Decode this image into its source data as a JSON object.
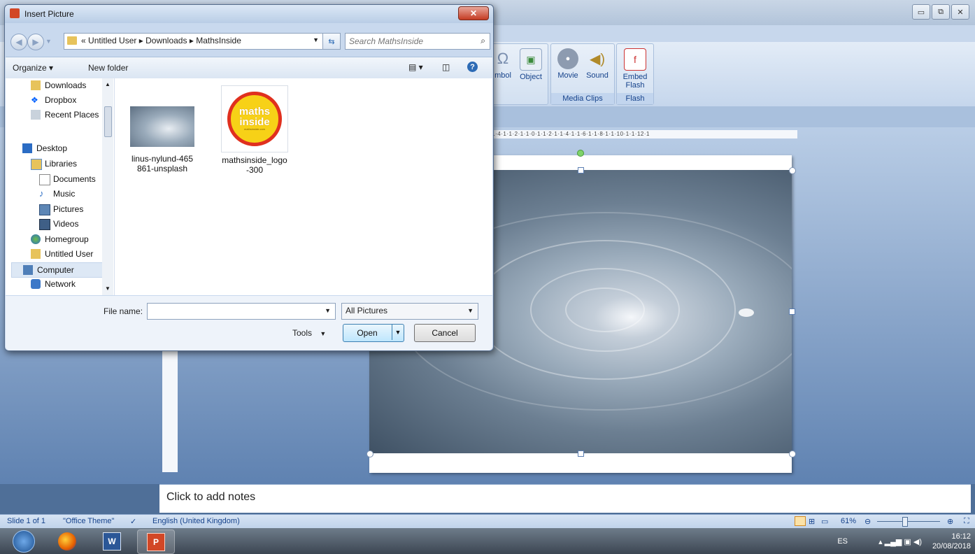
{
  "dialog": {
    "title": "Insert Picture",
    "breadcrumb": {
      "overflow": "«",
      "parts": [
        "Untitled User",
        "Downloads",
        "MathsInside"
      ],
      "separator": "▸"
    },
    "search_placeholder": "Search MathsInside",
    "toolbar": {
      "organize": "Organize ▾",
      "new_folder": "New folder"
    },
    "nav_items": [
      {
        "label": "Downloads",
        "icon": "downloads-folder-icon"
      },
      {
        "label": "Dropbox",
        "icon": "dropbox-icon"
      },
      {
        "label": "Recent Places",
        "icon": "recent-places-icon"
      },
      {
        "label": "Desktop",
        "icon": "desktop-icon"
      },
      {
        "label": "Libraries",
        "icon": "libraries-icon"
      },
      {
        "label": "Documents",
        "icon": "documents-icon"
      },
      {
        "label": "Music",
        "icon": "music-icon"
      },
      {
        "label": "Pictures",
        "icon": "pictures-icon"
      },
      {
        "label": "Videos",
        "icon": "videos-icon"
      },
      {
        "label": "Homegroup",
        "icon": "homegroup-icon"
      },
      {
        "label": "Untitled User",
        "icon": "user-folder-icon"
      },
      {
        "label": "Computer",
        "icon": "computer-icon"
      },
      {
        "label": "Network",
        "icon": "network-icon"
      }
    ],
    "files": [
      {
        "name_line1": "linus-nylund-465",
        "name_line2": "861-unsplash"
      },
      {
        "name_line1": "mathsinside_logo",
        "name_line2": "-300",
        "logo_line1": "maths",
        "logo_line2": "inside",
        "logo_url": "mathsinside.com"
      }
    ],
    "file_name_label": "File name:",
    "file_name_value": "",
    "file_type": "All Pictures",
    "tools_label": "Tools",
    "open_label": "Open",
    "cancel_label": "Cancel"
  },
  "ppt": {
    "ribbon": {
      "symbol_partial": "mbol",
      "object": "Object",
      "movie": "Movie",
      "sound": "Sound",
      "embed_flash_1": "Embed",
      "embed_flash_2": "Flash",
      "group_media": "Media Clips",
      "group_flash": "Flash"
    },
    "ruler_text": "·1·4·1·1·2·1·1·0·1·1·2·1·1·4·1·1·6·1·1·8·1·1·10·1·1·12·1",
    "notes_placeholder": "Click to add notes",
    "status": {
      "slide": "Slide 1 of 1",
      "theme": "\"Office Theme\"",
      "language": "English (United Kingdom)",
      "zoom": "61%"
    }
  },
  "taskbar": {
    "lang": "ES",
    "time": "16:12",
    "date": "20/08/2018"
  },
  "colors": {
    "accent": "#15428b",
    "close": "#c43b22",
    "logo_bg": "#f7d117"
  }
}
